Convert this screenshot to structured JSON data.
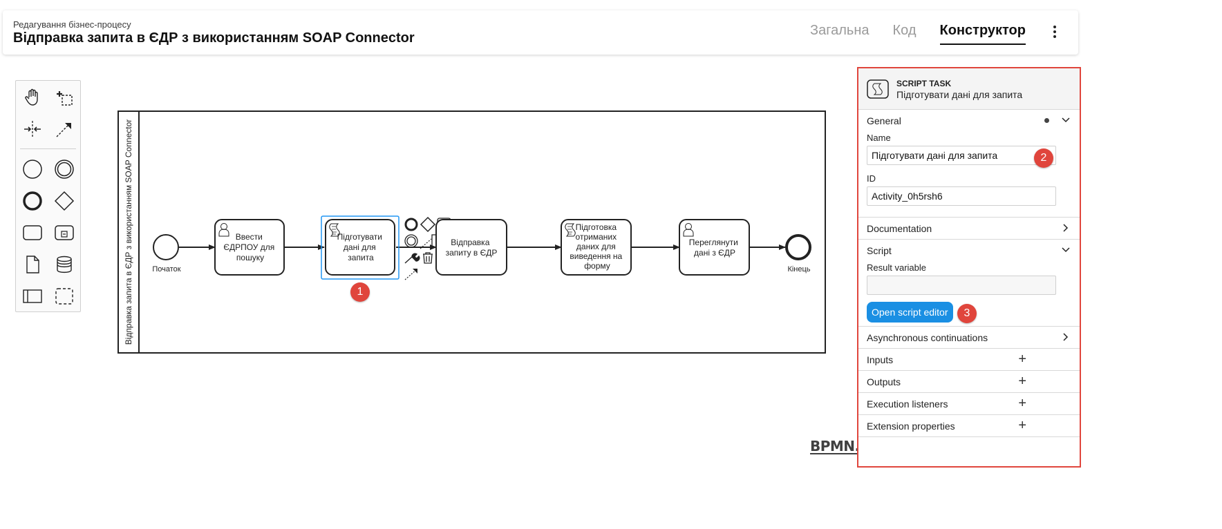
{
  "header": {
    "subtitle": "Редагування бізнес-процесу",
    "title": "Відправка запита в ЄДР з використанням SOAP Connector",
    "tabs": [
      "Загальна",
      "Код",
      "Конструктор"
    ],
    "active_tab": "Конструктор"
  },
  "diagram": {
    "pool_label": "Відправка запита в ЄДР з використанням SOAP Connector",
    "start_event": "Початок",
    "end_event": "Кінець",
    "tasks": [
      {
        "type": "user",
        "label": [
          "Ввести",
          "ЄДРПОУ для",
          "пошуку"
        ]
      },
      {
        "type": "script",
        "label": [
          "Підготувати",
          "дані для",
          "запита"
        ],
        "selected": true
      },
      {
        "type": "service",
        "label": [
          "Відправка",
          "запиту в ЄДР"
        ]
      },
      {
        "type": "script",
        "label": [
          "Підготовка",
          "отриманих",
          "даних для",
          "виведення на",
          "форму"
        ]
      },
      {
        "type": "user",
        "label": [
          "Переглянути",
          "дані з ЄДР"
        ]
      }
    ]
  },
  "badges": [
    "1",
    "2",
    "3"
  ],
  "panel": {
    "element_type": "SCRIPT TASK",
    "element_name": "Підготувати дані для запита",
    "general": {
      "title": "General",
      "name_label": "Name",
      "name_value": "Підготувати дані для запита",
      "id_label": "ID",
      "id_value": "Activity_0h5rsh6"
    },
    "documentation": "Documentation",
    "script": {
      "title": "Script",
      "result_variable_label": "Result variable",
      "result_variable_value": "",
      "open_editor_label": "Open script editor"
    },
    "async": "Asynchronous continuations",
    "inputs": "Inputs",
    "outputs": "Outputs",
    "execution_listeners": "Execution listeners",
    "extension_properties": "Extension properties"
  },
  "branding": "BPMN.iO",
  "colors": {
    "accent": "#1a8fe3",
    "badge": "#e0453c",
    "selection": "#2196f3"
  }
}
